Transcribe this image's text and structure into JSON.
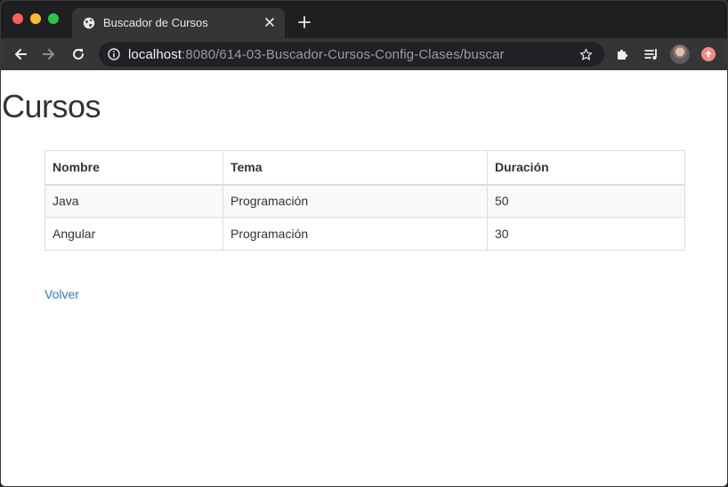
{
  "browser": {
    "tab_title": "Buscador de Cursos",
    "url_host": "localhost",
    "url_rest": ":8080/614-03-Buscador-Cursos-Config-Clases/buscar",
    "icons": [
      "globe-icon",
      "close-icon",
      "plus-icon",
      "back-arrow-icon",
      "forward-arrow-icon",
      "reload-icon",
      "info-icon",
      "star-icon",
      "puzzle-icon",
      "media-queue-icon",
      "avatar",
      "update-icon"
    ]
  },
  "page": {
    "title": "Cursos",
    "table": {
      "headers": [
        "Nombre",
        "Tema",
        "Duración"
      ],
      "rows": [
        [
          "Java",
          "Programación",
          "50"
        ],
        [
          "Angular",
          "Programación",
          "30"
        ]
      ]
    },
    "back_label": "Volver",
    "link_color": "#337ab7"
  }
}
